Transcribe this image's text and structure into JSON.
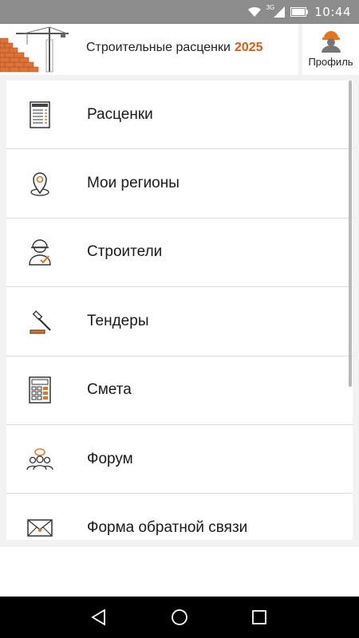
{
  "status_bar": {
    "network": "3G",
    "time": "10:44",
    "icons": [
      "wifi-icon",
      "signal-icon",
      "battery-icon"
    ]
  },
  "header": {
    "title": "Строительные расценки",
    "year": "2025",
    "profile_label": "Профиль"
  },
  "colors": {
    "accent": "#e05a10",
    "status_bar": "#8c8c8c",
    "nav_bar": "#000000"
  },
  "menu": {
    "items": [
      {
        "label": "Расценки",
        "icon": "price-list-icon"
      },
      {
        "label": "Мои регионы",
        "icon": "map-pin-icon"
      },
      {
        "label": "Строители",
        "icon": "builder-icon"
      },
      {
        "label": "Тендеры",
        "icon": "gavel-icon"
      },
      {
        "label": "Смета",
        "icon": "calculator-icon"
      },
      {
        "label": "Форум",
        "icon": "forum-icon"
      },
      {
        "label": "Форма обратной связи",
        "icon": "envelope-icon"
      }
    ]
  },
  "nav_bar": {
    "buttons": [
      "back-icon",
      "home-icon",
      "recents-icon"
    ]
  }
}
